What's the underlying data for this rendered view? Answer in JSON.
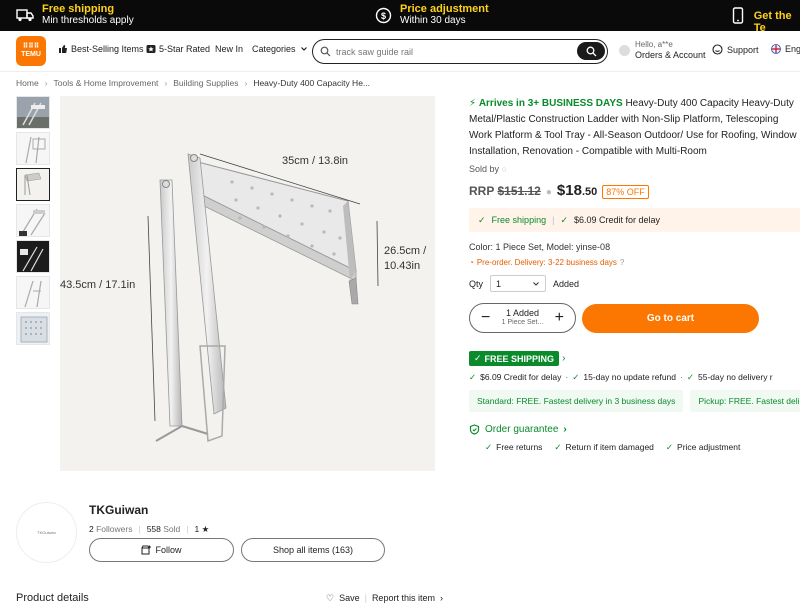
{
  "promo": {
    "free_shipping_title": "Free shipping",
    "free_shipping_sub": "Min thresholds apply",
    "price_adjust_title": "Price adjustment",
    "price_adjust_sub": "Within 30 days",
    "get_app": "Get the Te"
  },
  "header": {
    "logo_line1": "⠿⠿⠿",
    "logo_line2": "TEMU",
    "nav": [
      "Best-Selling Items",
      "5-Star Rated",
      "New In",
      "Categories"
    ],
    "search_placeholder": "track saw guide rail",
    "hello": "Hello, a**e",
    "orders": "Orders & Account",
    "support": "Support",
    "language": "Engli"
  },
  "breadcrumb": [
    "Home",
    "Tools & Home Improvement",
    "Building Supplies",
    "Heavy-Duty 400 Capacity He..."
  ],
  "image": {
    "dim_top": "35cm / 13.8in",
    "dim_right_1": "26.5cm /",
    "dim_right_2": "10.43in",
    "dim_left": "43.5cm / 17.1in"
  },
  "product": {
    "arrival": "Arrives in 3+ BUSINESS DAYS",
    "title": "Heavy-Duty 400 Capacity Heavy-Duty Metal/Plastic Construction Ladder with Non-Slip Platform, Telescoping Work Platform & Tool Tray - All-Season Outdoor/ Use for Roofing, Window Installation, Renovation - Compatible with Multi-Room",
    "sold_by": "Sold by",
    "rrp_label": "RRP",
    "rrp_value": "$151.12",
    "price_main": "$18",
    "price_cents": ".50",
    "discount": "87% OFF",
    "free_shipping": "Free shipping",
    "credit": "$6.09 Credit for delay",
    "color_line": "Color: 1 Piece Set, Model: yinse-08",
    "preorder": "Pre-order. Delivery: 3-22 business days",
    "qty_label": "Qty",
    "qty_value": "1",
    "added": "Added",
    "stepper_top": "1 Added",
    "stepper_sub": "1 Piece Set...",
    "go_to_cart": "Go to cart",
    "free_shipping_badge": "FREE SHIPPING",
    "perks": [
      "$6.09 Credit for delay",
      "15-day no update refund",
      "55-day no delivery r"
    ],
    "delivery_standard": "Standard: FREE. Fastest delivery in 3 business days",
    "delivery_pickup": "Pickup: FREE. Fastest deli",
    "order_guarantee": "Order guarantee",
    "guarantees": [
      "Free returns",
      "Return if item damaged",
      "Price adjustment"
    ]
  },
  "store": {
    "logo_text": "TKGuiwan",
    "name": "TKGuiwan",
    "followers_num": "2",
    "followers_label": "Followers",
    "sold_num": "558",
    "sold_label": "Sold",
    "rating": "1 ★",
    "follow": "Follow",
    "shop_all": "Shop all items (163)"
  },
  "footer": {
    "product_details": "Product details",
    "save": "Save",
    "report": "Report this item"
  },
  "colors": {
    "accent": "#fb7701",
    "green": "#0a8a2b",
    "promo_yellow": "#ffd21a"
  }
}
